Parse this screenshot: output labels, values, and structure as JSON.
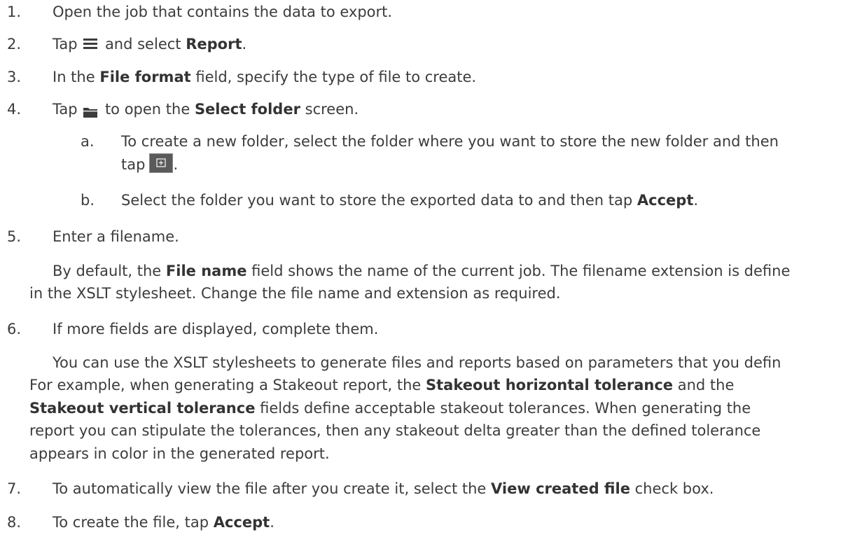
{
  "steps": [
    {
      "num": "1.",
      "text": "Open the job that contains the data to export."
    },
    {
      "num": "2.",
      "pre": "Tap",
      "mid": "and select",
      "bold": "Report",
      "post": "."
    },
    {
      "num": "3.",
      "pre": "In the",
      "bold": "File format",
      "post": "field, specify the type of file to create."
    },
    {
      "num": "4.",
      "pre": "Tap",
      "mid": "to open the",
      "bold": "Select folder",
      "post": "screen."
    },
    {
      "num": "5.",
      "text": "Enter a filename."
    },
    {
      "num": "6.",
      "text": "If more fields are displayed, complete them."
    },
    {
      "num": "7.",
      "pre": "To automatically view the file after you create it, select the",
      "bold": "View created file",
      "post": "check box."
    },
    {
      "num": "8.",
      "pre": "To create the file, tap",
      "bold": "Accept",
      "post": "."
    }
  ],
  "substeps": [
    {
      "num": "a.",
      "line1": "To create a new folder, select the folder where you want to store the new folder and then",
      "line2_pre": "tap",
      "line2_post": "."
    },
    {
      "num": "b.",
      "pre": "Select the folder you want to store the exported data to and then tap",
      "bold": "Accept",
      "post": "."
    }
  ],
  "step5_note": {
    "pre": "By default, the",
    "bold": "File name",
    "post": "field shows the name of the current job. The filename extension is define",
    "line2": "in the XSLT stylesheet. Change the file name and extension as required."
  },
  "step6_note": {
    "line1": "You can use the XSLT stylesheets to generate files and reports based on parameters that you defin",
    "line2_pre": "For example, when generating a Stakeout report, the",
    "line2_bold": "Stakeout horizontal tolerance",
    "line2_post": "and the",
    "line3_bold": "Stakeout vertical tolerance",
    "line3_post": "fields define acceptable stakeout tolerances. When generating the",
    "line4": "report you can stipulate the tolerances, then any stakeout delta greater than the defined tolerance",
    "line5": "appears in color in the generated report."
  },
  "icons": {
    "menu": "menu-icon",
    "folder": "folder-icon",
    "new_folder": "new-folder-icon"
  }
}
